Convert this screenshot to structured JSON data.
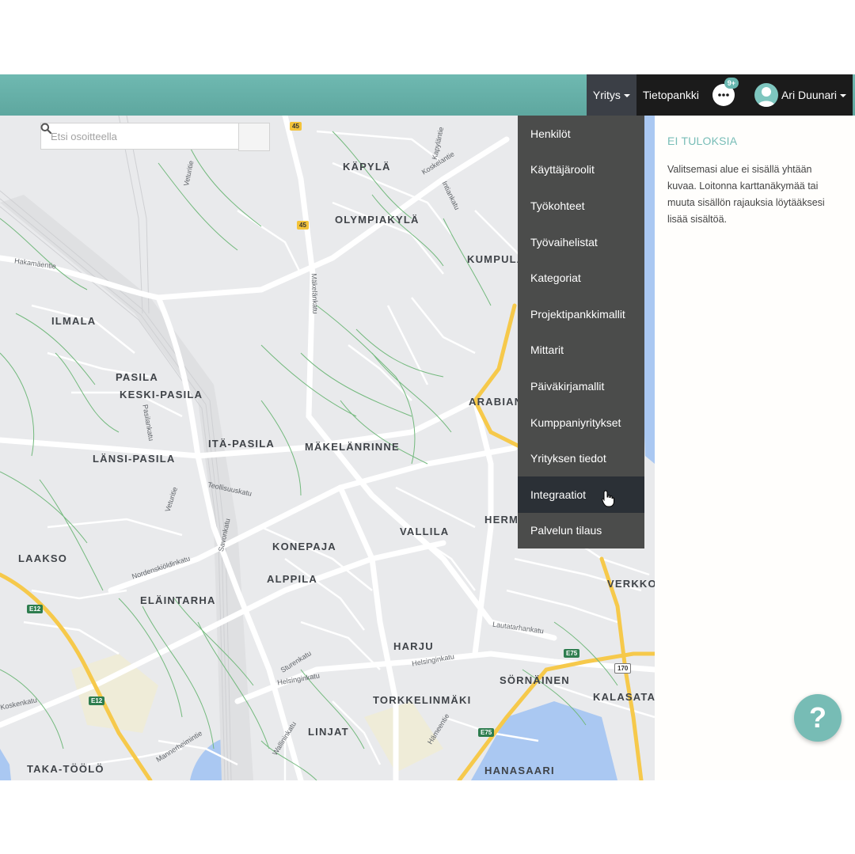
{
  "topnav": {
    "company_menu": "Yritys",
    "knowledge_bank": "Tietopankki",
    "chat_badge": "9+",
    "user_name": "Ari Duunari"
  },
  "search": {
    "placeholder": "Etsi osoitteella"
  },
  "dropdown": {
    "items": [
      {
        "label": "Henkilöt"
      },
      {
        "label": "Käyttäjäroolit"
      },
      {
        "label": "Työkohteet"
      },
      {
        "label": "Työvaihelistat"
      },
      {
        "label": "Kategoriat"
      },
      {
        "label": "Projektipankkimallit"
      },
      {
        "label": "Mittarit"
      },
      {
        "label": "Päiväkirjamallit"
      },
      {
        "label": "Kumppaniyritykset"
      },
      {
        "label": "Yrityksen tiedot"
      },
      {
        "label": "Integraatiot"
      },
      {
        "label": "Palvelun tilaus"
      }
    ],
    "hovered": "Integraatiot"
  },
  "map": {
    "districts": [
      "KÄPYLÄ",
      "OLYMPIAKYLÄ",
      "KUMPULA",
      "ILMALA",
      "PASILA",
      "KESKI-PASILA",
      "ITÄ-PASILA",
      "MÄKELÄNRINNE",
      "ARABIAN",
      "LÄNSI-PASILA",
      "HERMANNI",
      "VALLILA",
      "LAAKSO",
      "KONEPAJA",
      "ALPPILA",
      "ELÄINTARHA",
      "VERKKOS",
      "HARJU",
      "SÖRNÄINEN",
      "TORKKELINMÄKI",
      "KALASATAN",
      "LINJAT",
      "TAKA-TÖÖLÖ",
      "HANASAARI"
    ],
    "streets": [
      "Hakamäentie",
      "Koskelantie",
      "Veturitie",
      "Mäkelänkatu",
      "Kapyläntie",
      "Intiankatu",
      "Pasilankatu",
      "Teollisuuskatu",
      "Savonkatu",
      "Nordenskiöldinkatu",
      "Sturenkatu",
      "Helsinginkatu",
      "Lautatarhankatu",
      "Wallininkatu",
      "Hämeentie",
      "Helsinginkatu",
      "Koskenkatu",
      "Mannerheimintie",
      "Veturitie"
    ],
    "shields": [
      "45",
      "45",
      "E12",
      "E12",
      "E75",
      "E75",
      "170"
    ]
  },
  "results": {
    "title": "EI TULOKSIA",
    "message": "Valitsemasi alue ei sisällä yhtään kuvaa. Loitonna karttanäkymää tai muuta sisällön rajauksia löytääksesi lisää sisältöä."
  },
  "help": {
    "label": "?"
  },
  "colors": {
    "accent": "#6fb9b1",
    "menu_bg": "#4b4c4b",
    "menu_hover": "#2b3036"
  }
}
